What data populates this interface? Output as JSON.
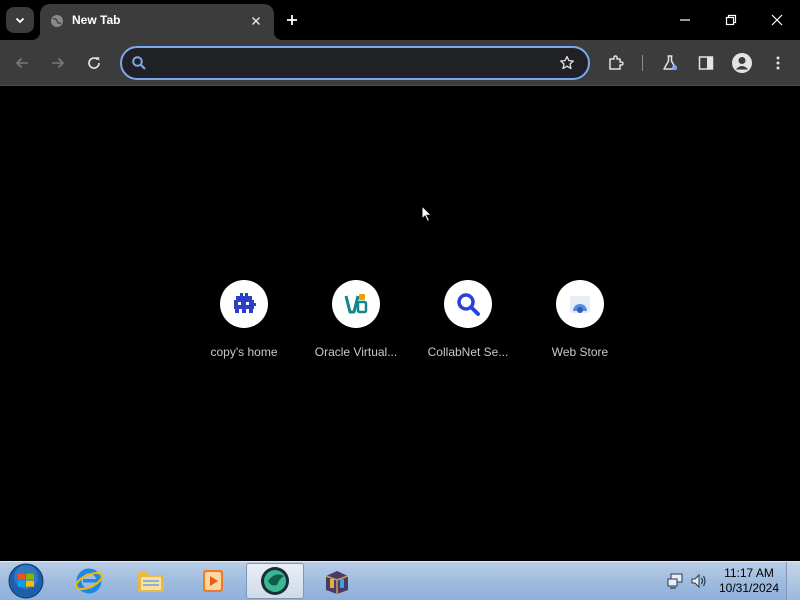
{
  "browser": {
    "tab": {
      "title": "New Tab",
      "favicon": "globe-icon"
    },
    "tab_search_icon": "chevron-down-icon",
    "new_tab_icon": "plus-icon",
    "window_controls": [
      "minimize-icon",
      "restore-icon",
      "close-icon"
    ]
  },
  "toolbar": {
    "back_icon": "arrow-left-icon",
    "forward_icon": "arrow-right-icon",
    "reload_icon": "reload-icon",
    "omnibox": {
      "value": "",
      "placeholder": "",
      "icon": "search-icon"
    },
    "bookmark_icon": "star-icon",
    "right_icons": [
      "extensions-icon",
      "labs-flask-icon",
      "side-panel-icon",
      "profile-icon",
      "kebab-menu-icon"
    ]
  },
  "shortcuts": [
    {
      "label": "copy's home",
      "icon": "pixel-monster-icon"
    },
    {
      "label": "Oracle Virtual...",
      "icon": "virtualbox-icon"
    },
    {
      "label": "CollabNet Se...",
      "icon": "search-icon"
    },
    {
      "label": "Web Store",
      "icon": "web-store-icon"
    }
  ],
  "taskbar": {
    "apps": [
      "internet-explorer-icon",
      "windows-explorer-icon",
      "media-player-icon",
      "chrome-icon",
      "archive-icon"
    ],
    "clock": {
      "time": "11:17 AM",
      "date": "10/31/2024"
    },
    "tray": [
      "network-icon",
      "volume-icon"
    ]
  },
  "colors": {
    "accent": "#7ca7f0",
    "toolbar_bg": "#3c3c3c",
    "content_bg": "#000000",
    "taskbar_bg": "#9fbcdf"
  }
}
